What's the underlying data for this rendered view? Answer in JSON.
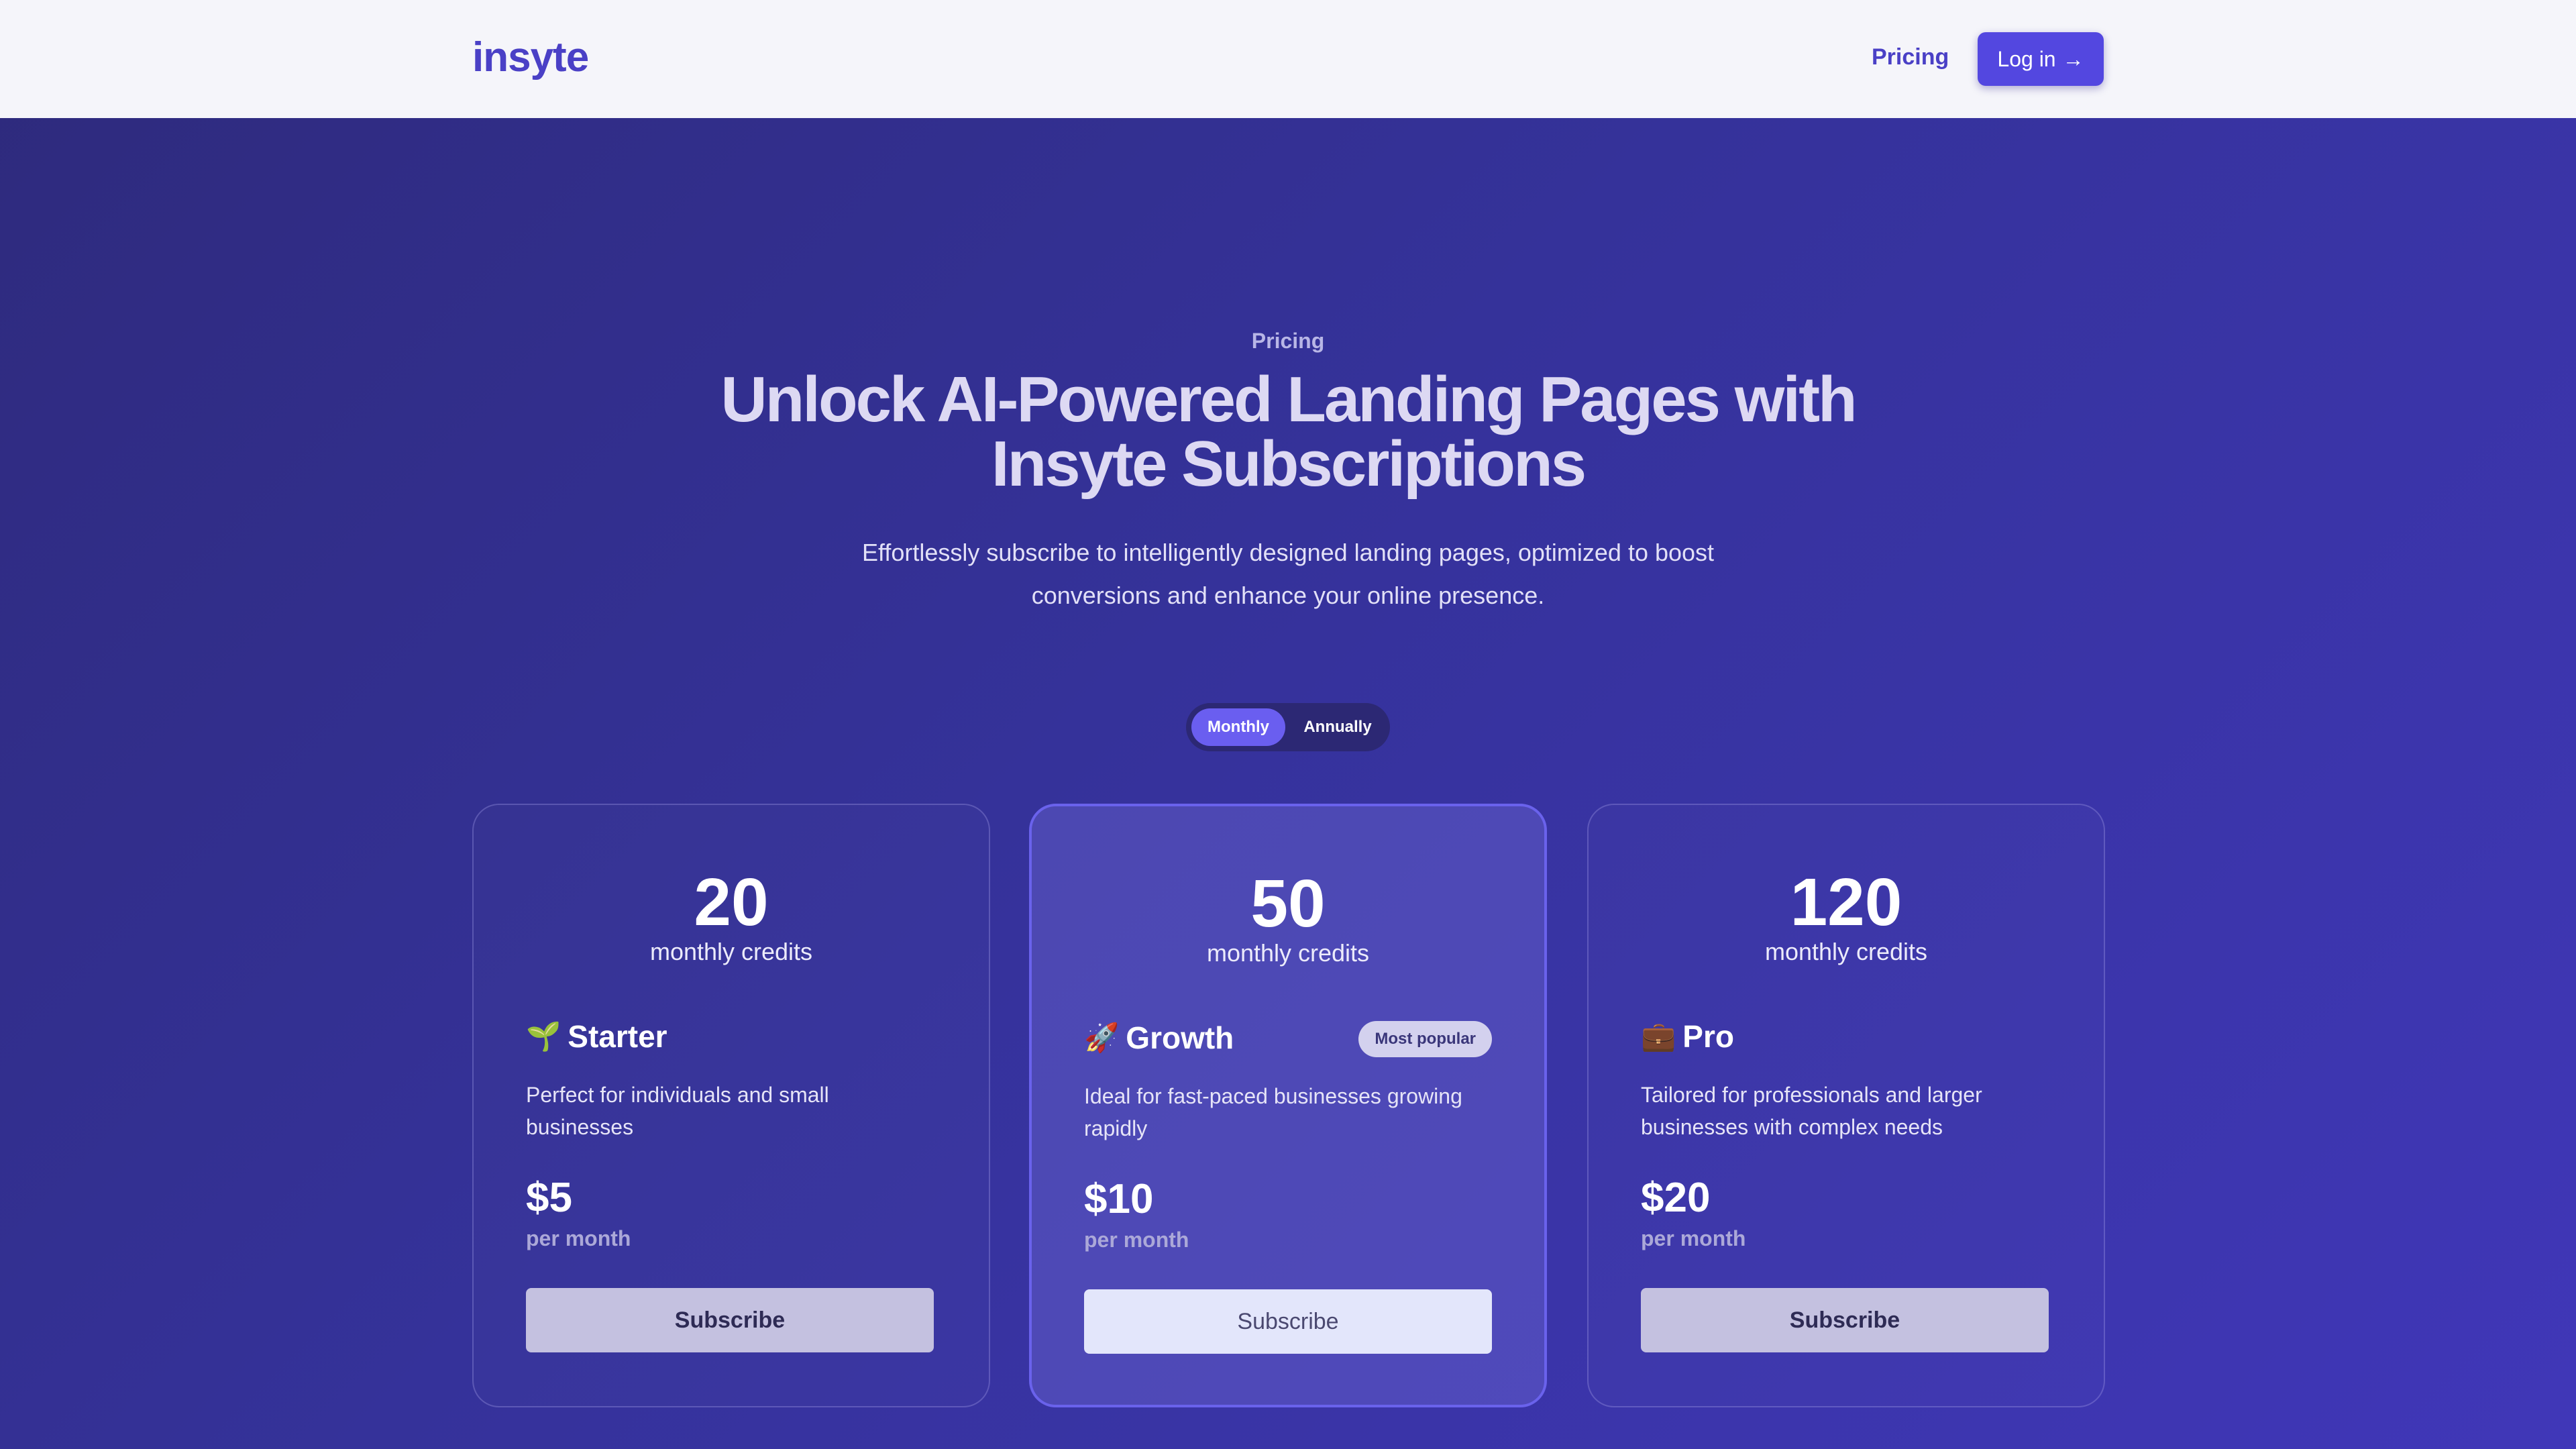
{
  "header": {
    "logo": "insyte",
    "nav_pricing": "Pricing",
    "login_label": "Log in",
    "login_arrow": "→"
  },
  "hero": {
    "eyebrow": "Pricing",
    "headline": "Unlock AI-Powered Landing Pages with Insyte Subscriptions",
    "subtext": "Effortlessly subscribe to intelligently designed landing pages, optimized to boost conversions and enhance your online presence."
  },
  "billing_toggle": {
    "options": [
      "Monthly",
      "Annually"
    ],
    "selected": "Monthly"
  },
  "plans": [
    {
      "credits": "20",
      "credits_label": "monthly credits",
      "emoji": "🌱",
      "name": "Starter",
      "description": "Perfect for individuals and small businesses",
      "price": "$5",
      "price_unit": "per month",
      "cta": "Subscribe"
    },
    {
      "credits": "50",
      "credits_label": "monthly credits",
      "emoji": "🚀",
      "name": "Growth",
      "badge": "Most popular",
      "description": "Ideal for fast-paced businesses growing rapidly",
      "price": "$10",
      "price_unit": "per month",
      "cta": "Subscribe"
    },
    {
      "credits": "120",
      "credits_label": "monthly credits",
      "emoji": "💼",
      "name": "Pro",
      "description": "Tailored for professionals and larger businesses with complex needs",
      "price": "$20",
      "price_unit": "per month",
      "cta": "Subscribe"
    }
  ],
  "colors": {
    "brand": "#4a40c6",
    "primary_button": "#5347e0",
    "background_start": "#2e2a7c",
    "background_end": "#4037b8",
    "featured_border": "#6a62ec"
  }
}
